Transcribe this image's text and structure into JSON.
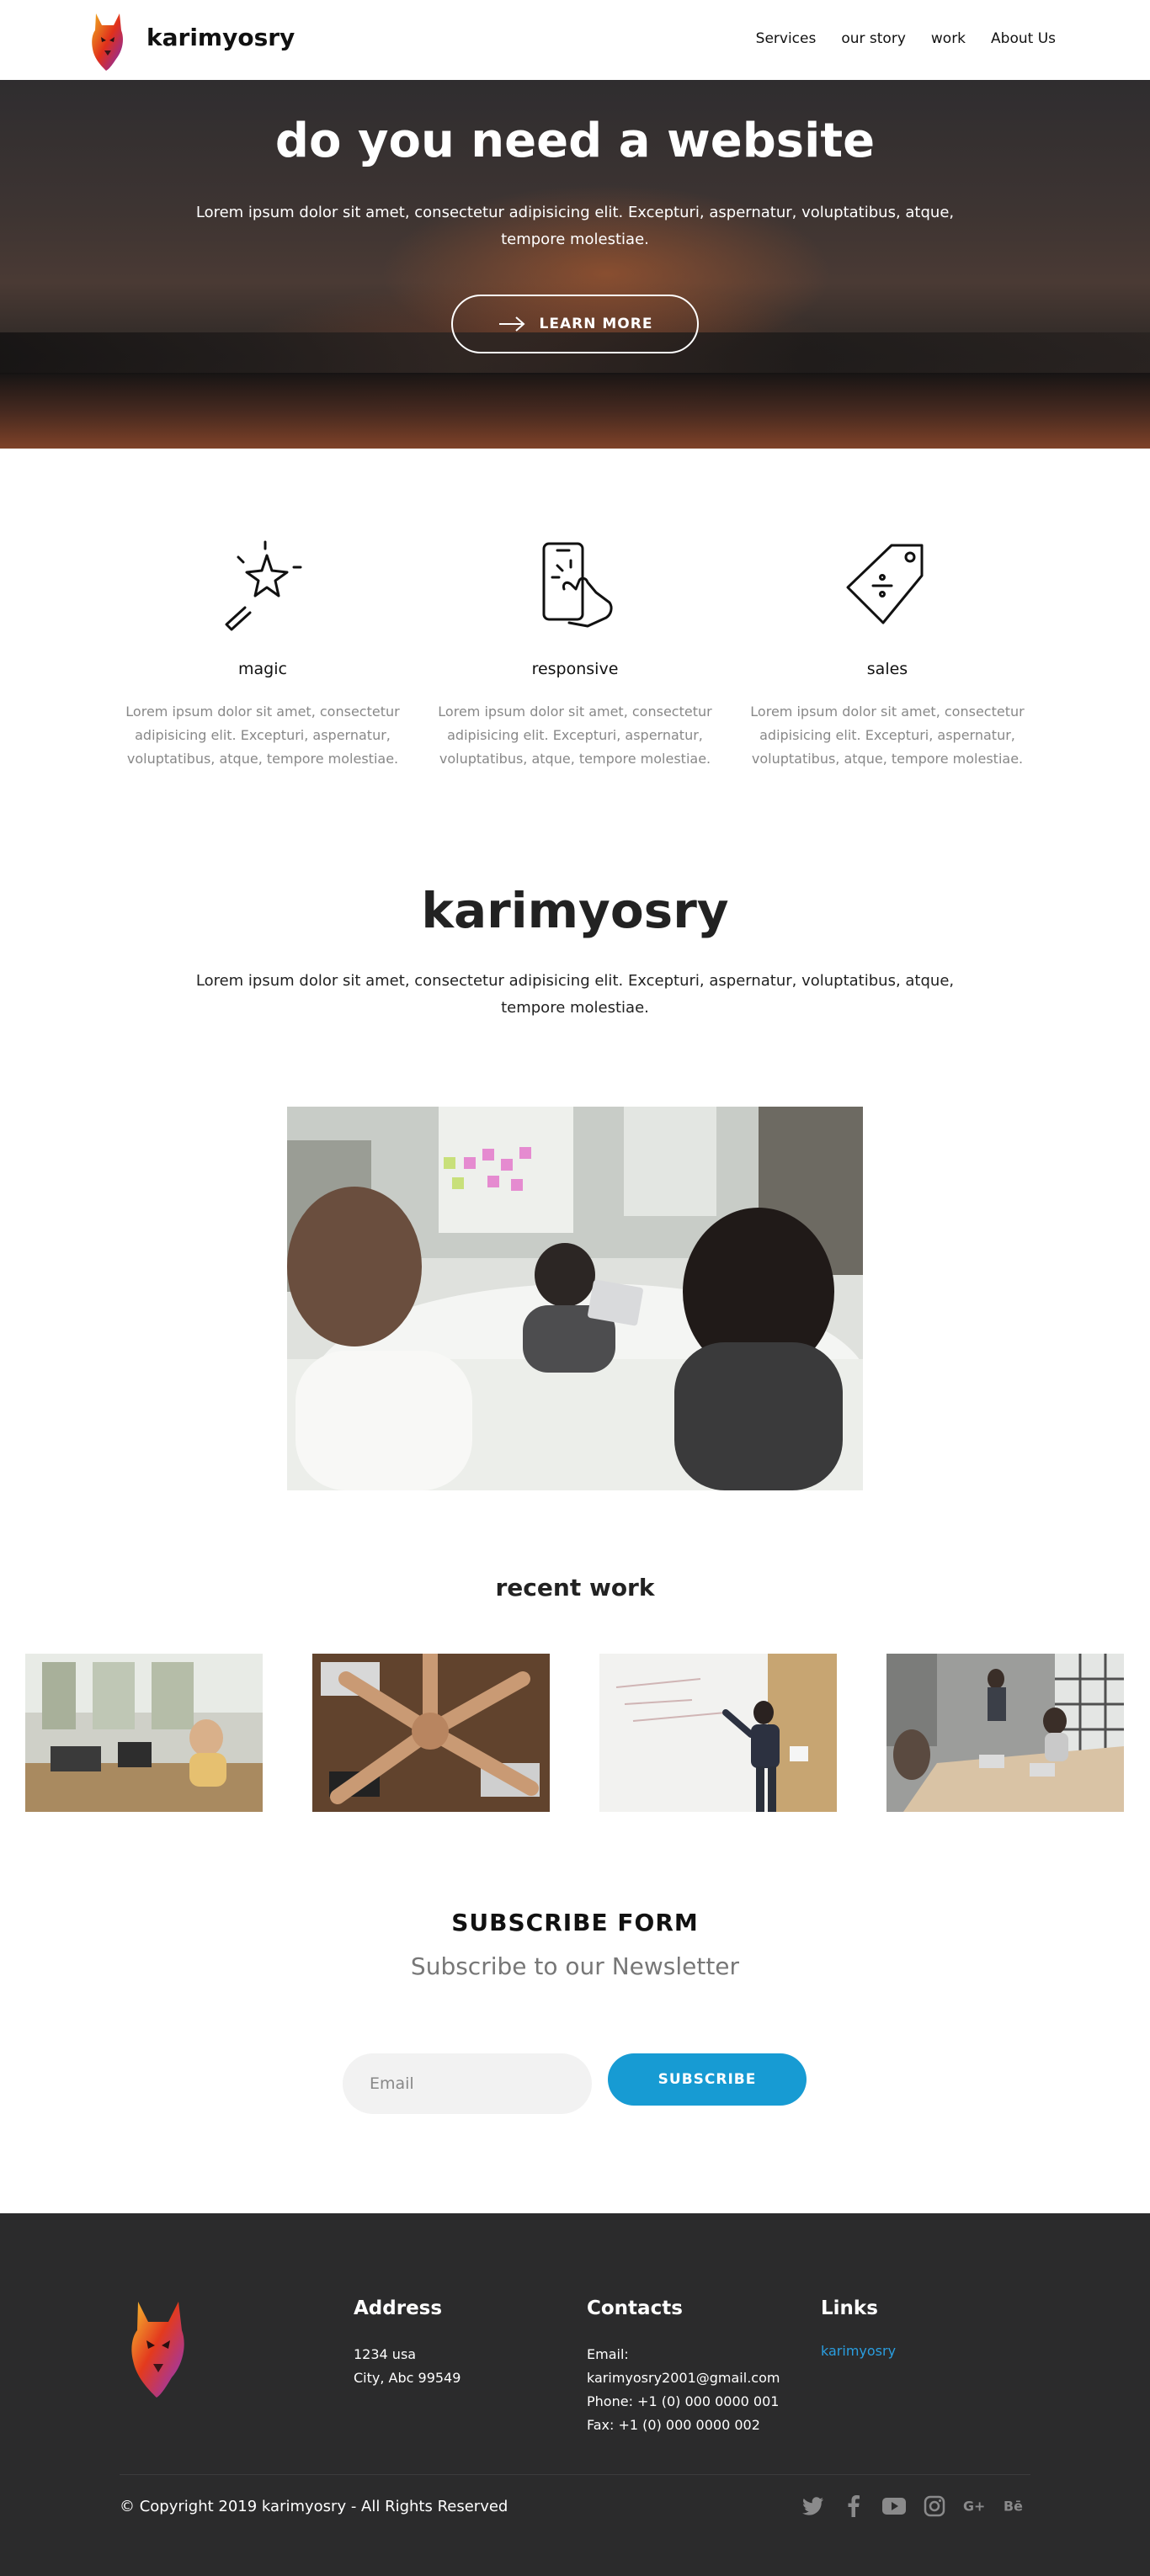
{
  "header": {
    "brand": "karimyosry",
    "nav": [
      "Services",
      "our story",
      "work",
      "About Us"
    ]
  },
  "hero": {
    "title": "do you need a website",
    "text": "Lorem ipsum dolor sit amet, consectetur adipisicing elit. Excepturi, aspernatur, voluptatibus, atque, tempore molestiae.",
    "button": "LEARN MORE"
  },
  "features": [
    {
      "icon": "magic-wand-icon",
      "title": "magic",
      "text": "Lorem ipsum dolor sit amet, consectetur adipisicing elit. Excepturi, aspernatur, voluptatibus, atque, tempore molestiae."
    },
    {
      "icon": "touch-phone-icon",
      "title": "responsive",
      "text": "Lorem ipsum dolor sit amet, consectetur adipisicing elit. Excepturi, aspernatur, voluptatibus, atque, tempore molestiae."
    },
    {
      "icon": "price-tag-icon",
      "title": "sales",
      "text": "Lorem ipsum dolor sit amet, consectetur adipisicing elit. Excepturi, aspernatur, voluptatibus, atque, tempore molestiae."
    }
  ],
  "about": {
    "title": "karimyosry",
    "text": "Lorem ipsum dolor sit amet, consectetur adipisicing elit. Excepturi, aspernatur, voluptatibus, atque, tempore molestiae."
  },
  "recent": {
    "title": "recent work"
  },
  "subscribe": {
    "title": "SUBSCRIBE FORM",
    "subtitle": "Subscribe to our Newsletter",
    "email_placeholder": "Email",
    "button": "SUBSCRIBE"
  },
  "footer": {
    "address_title": "Address",
    "address_lines": [
      "1234 usa",
      "City, Abc 99549"
    ],
    "contacts_title": "Contacts",
    "contacts_lines": [
      "Email:",
      "karimyosry2001@gmail.com",
      "Phone: +1 (0) 000 0000 001",
      "Fax: +1 (0) 000 0000 002"
    ],
    "links_title": "Links",
    "links": [
      "karimyosry"
    ],
    "copyright": "© Copyright 2019 karimyosry - All Rights Reserved",
    "social": [
      "twitter-icon",
      "facebook-icon",
      "youtube-icon",
      "instagram-icon",
      "google-plus-icon",
      "behance-icon"
    ]
  },
  "colors": {
    "accent": "#179bd3",
    "link": "#2a9ee0",
    "footer_bg": "#2b2b2c"
  }
}
